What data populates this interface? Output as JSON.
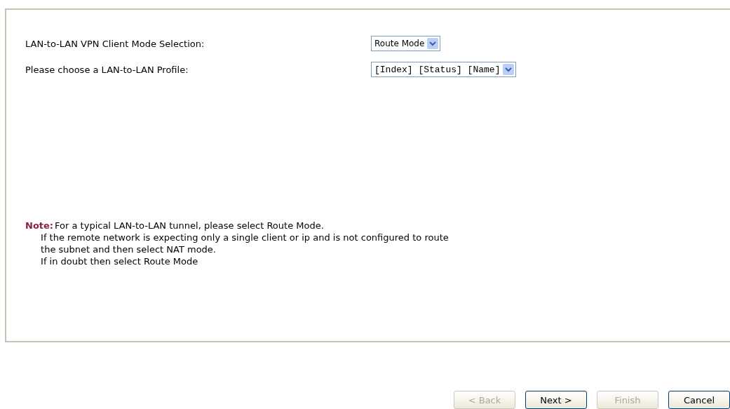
{
  "form": {
    "fields": [
      {
        "label": "LAN-to-LAN VPN Client Mode Selection:",
        "value": "Route Mode",
        "kind": "mode"
      },
      {
        "label": "Please choose a LAN-to-LAN Profile:",
        "value": "[Index] [Status] [Name]",
        "kind": "profile"
      }
    ],
    "note": {
      "label": "Note:",
      "lines": [
        "For a typical LAN-to-LAN tunnel, please select Route Mode.",
        "If the remote network is expecting only a single client or ip and is not configured to route",
        "the subnet and then select NAT mode.",
        "If in doubt then select Route Mode"
      ]
    }
  },
  "buttons": [
    {
      "label": "< Back",
      "disabled": true
    },
    {
      "label": "Next >",
      "disabled": false
    },
    {
      "label": "Finish",
      "disabled": true
    },
    {
      "label": "Cancel",
      "disabled": false
    }
  ]
}
